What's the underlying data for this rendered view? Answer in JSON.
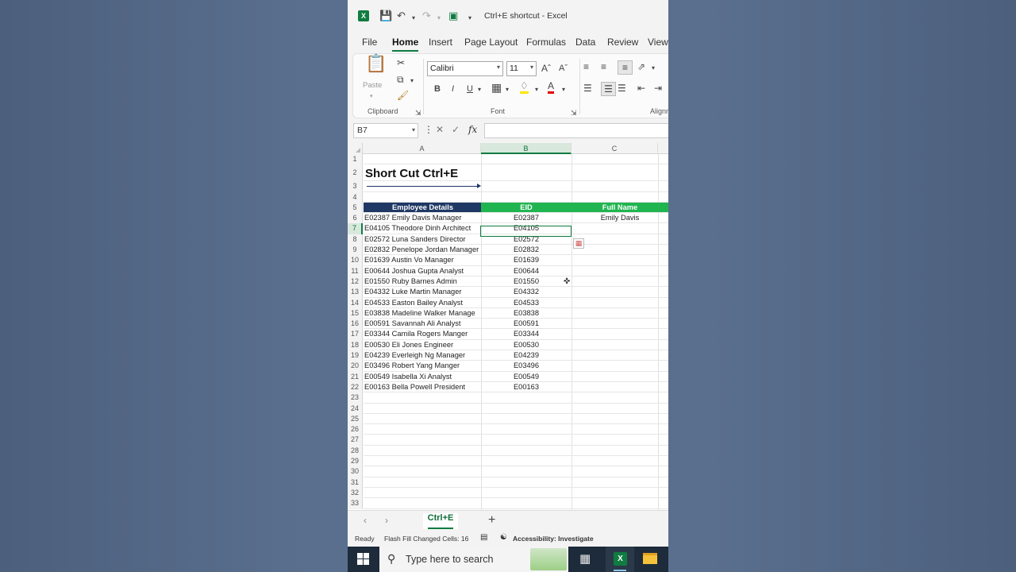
{
  "titlebar": {
    "title": "Ctrl+E shortcut  -  Excel"
  },
  "menu": {
    "tabs": [
      "File",
      "Home",
      "Insert",
      "Page Layout",
      "Formulas",
      "Data",
      "Review",
      "View"
    ],
    "active": "Home"
  },
  "ribbon": {
    "paste_label": "Paste",
    "clipboard_label": "Clipboard",
    "font_label": "Font",
    "alignment_label": "Alignm",
    "font_name": "Calibri",
    "font_size": "11",
    "bold": "B",
    "italic": "I",
    "underline": "U"
  },
  "formula_bar": {
    "name_box": "B7",
    "fx": "fx",
    "formula": ""
  },
  "columns": [
    "A",
    "B",
    "C"
  ],
  "sheet": {
    "title": "Short Cut Ctrl+E",
    "headers": {
      "a": "Employee Details",
      "b": "EID",
      "c": "Full Name"
    },
    "rows": [
      {
        "a": "E02387  Emily Davis Manager",
        "b": "E02387",
        "c": "Emily Davis"
      },
      {
        "a": "E04105 Theodore Dinh Architect",
        "b": "E04105",
        "c": ""
      },
      {
        "a": "E02572 Luna Sanders Director",
        "b": "E02572",
        "c": ""
      },
      {
        "a": "E02832 Penelope Jordan Manager",
        "b": "E02832",
        "c": ""
      },
      {
        "a": "E01639 Austin Vo Manager",
        "b": "E01639",
        "c": ""
      },
      {
        "a": "E00644 Joshua Gupta Analyst",
        "b": "E00644",
        "c": ""
      },
      {
        "a": "E01550 Ruby Barnes Admin",
        "b": "E01550",
        "c": ""
      },
      {
        "a": "E04332 Luke Martin Manager",
        "b": "E04332",
        "c": ""
      },
      {
        "a": "E04533 Easton Bailey Analyst",
        "b": "E04533",
        "c": ""
      },
      {
        "a": "E03838 Madeline Walker Manage",
        "b": "E03838",
        "c": ""
      },
      {
        "a": "E00591 Savannah Ali Analyst",
        "b": "E00591",
        "c": ""
      },
      {
        "a": "E03344 Camila Rogers Manger",
        "b": "E03344",
        "c": ""
      },
      {
        "a": "E00530 Eli Jones Engineer",
        "b": "E00530",
        "c": ""
      },
      {
        "a": "E04239 Everleigh Ng Manager",
        "b": "E04239",
        "c": ""
      },
      {
        "a": "E03496 Robert Yang Manger",
        "b": "E03496",
        "c": ""
      },
      {
        "a": "E00549 Isabella Xi Analyst",
        "b": "E00549",
        "c": ""
      },
      {
        "a": "E00163 Bella Powell President",
        "b": "E00163",
        "c": ""
      }
    ],
    "row_numbers": [
      "1",
      "2",
      "3",
      "4",
      "5",
      "6",
      "7",
      "8",
      "9",
      "10",
      "11",
      "12",
      "13",
      "14",
      "15",
      "16",
      "17",
      "18",
      "19",
      "20",
      "21",
      "22",
      "23",
      "24",
      "25",
      "26",
      "27",
      "28",
      "29",
      "30",
      "31",
      "32",
      "33"
    ],
    "selected_row": "7"
  },
  "sheet_tabs": {
    "active": "Ctrl+E"
  },
  "status": {
    "ready": "Ready",
    "flash_fill": "Flash Fill Changed Cells: 16",
    "accessibility": "Accessibility: Investigate"
  },
  "taskbar": {
    "search_placeholder": "Type here to search"
  },
  "colors": {
    "header_dark": "#1f3864",
    "header_green": "#21b551",
    "excel_green": "#107c41"
  }
}
